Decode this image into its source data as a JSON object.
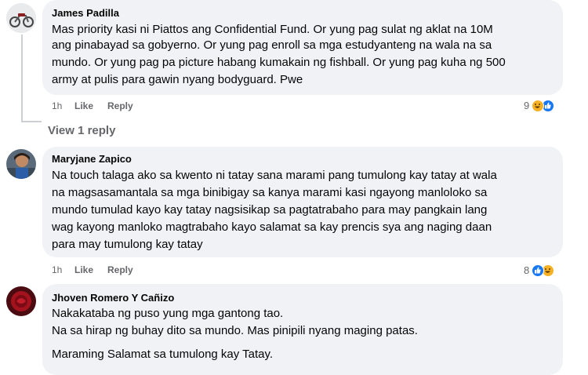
{
  "comments": [
    {
      "author": "James Padilla",
      "lines": [
        "Mas priority kasi ni Piattos ang Confidential Fund. Or yung pag sulat ng aklat na 10M",
        "ang pinabayad sa gobyerno. Or yung pag enroll sa mga estudyanteng na wala na sa",
        "mundo. Or yung pag pa picture habang kumakain ng fishball. Or yung pag kuha ng 500",
        "army at pulis para gawin nyang bodyguard. Pwe"
      ],
      "time": "1h",
      "like_label": "Like",
      "reply_label": "Reply",
      "reaction_count": "9",
      "reactions": [
        "haha-icon",
        "like-icon"
      ],
      "view_replies": "View 1 reply"
    },
    {
      "author": "Maryjane Zapico",
      "lines": [
        "Na touch talaga ako sa kwento ni tatay sana marami pang tumulong kay tatay at wala",
        "na magsasamantala sa mga binibigay sa kanya marami kasi ngayong manloloko sa",
        "mundo tumulad kayo kay tatay nagsisikap sa pagtatrabaho para may pangkain lang",
        "wag kayong manloko magtrabaho kayo salamat sa kay prencis sya ang naging daan",
        "para may tumulong kay tatay"
      ],
      "time": "1h",
      "like_label": "Like",
      "reply_label": "Reply",
      "reaction_count": "8",
      "reactions": [
        "like-icon",
        "haha-icon"
      ]
    },
    {
      "author": "Jhoven Romero Y Cañizo",
      "lines": [
        "Nakakataba ng puso yung mga gantong tao.",
        "Na sa hirap ng buhay dito sa mundo. Mas pinipili nyang maging patas.",
        "",
        "Maraming Salamat sa tumulong kay Tatay."
      ]
    }
  ],
  "colors": {
    "bubble": "#f0f2f5",
    "meta_text": "#65676b",
    "like_blue": "#1877f2",
    "haha_yellow": "#f7b125"
  }
}
